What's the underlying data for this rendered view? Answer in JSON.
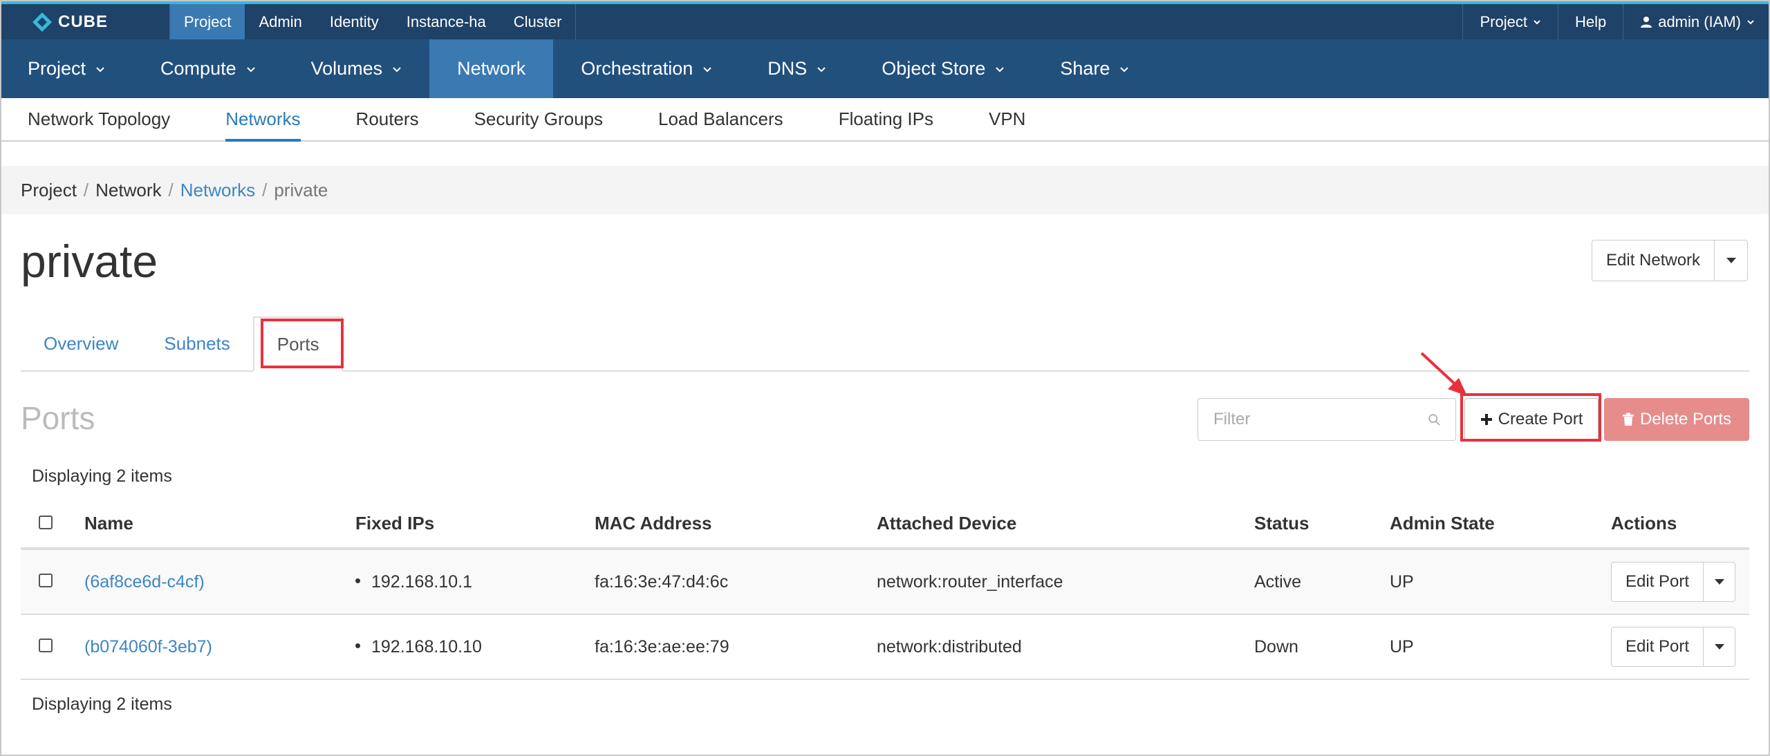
{
  "brand": {
    "name": "CUBE"
  },
  "context_nav": [
    "Project",
    "Admin",
    "Identity",
    "Instance-ha",
    "Cluster"
  ],
  "topbar_right": {
    "project": "Project",
    "help": "Help",
    "user": "admin (IAM)"
  },
  "main_nav": [
    "Project",
    "Compute",
    "Volumes",
    "Network",
    "Orchestration",
    "DNS",
    "Object Store",
    "Share"
  ],
  "sub_nav": [
    "Network Topology",
    "Networks",
    "Routers",
    "Security Groups",
    "Load Balancers",
    "Floating IPs",
    "VPN"
  ],
  "breadcrumb": {
    "project": "Project",
    "network": "Network",
    "networks": "Networks",
    "current": "private",
    "sep": "/"
  },
  "page": {
    "title": "private",
    "edit_network": "Edit Network"
  },
  "tabs": [
    "Overview",
    "Subnets",
    "Ports"
  ],
  "ports": {
    "heading": "Ports",
    "filter_placeholder": "Filter",
    "create_port": "Create Port",
    "delete_ports": "Delete Ports",
    "count_text": "Displaying 2 items",
    "columns": [
      "Name",
      "Fixed IPs",
      "MAC Address",
      "Attached Device",
      "Status",
      "Admin State",
      "Actions"
    ],
    "rows": [
      {
        "name": "(6af8ce6d-c4cf)",
        "fixed_ip": "192.168.10.1",
        "mac": "fa:16:3e:47:d4:6c",
        "device": "network:router_interface",
        "status": "Active",
        "admin_state": "UP",
        "action": "Edit Port"
      },
      {
        "name": "(b074060f-3eb7)",
        "fixed_ip": "192.168.10.10",
        "mac": "fa:16:3e:ae:ee:79",
        "device": "network:distributed",
        "status": "Down",
        "admin_state": "UP",
        "action": "Edit Port"
      }
    ]
  },
  "colors": {
    "topbar": "#1e4268",
    "mainnav": "#22507d",
    "active": "#3a79b2",
    "link": "#3d86c4",
    "highlight": "#e8313e",
    "danger_disabled": "#e68d8c"
  }
}
